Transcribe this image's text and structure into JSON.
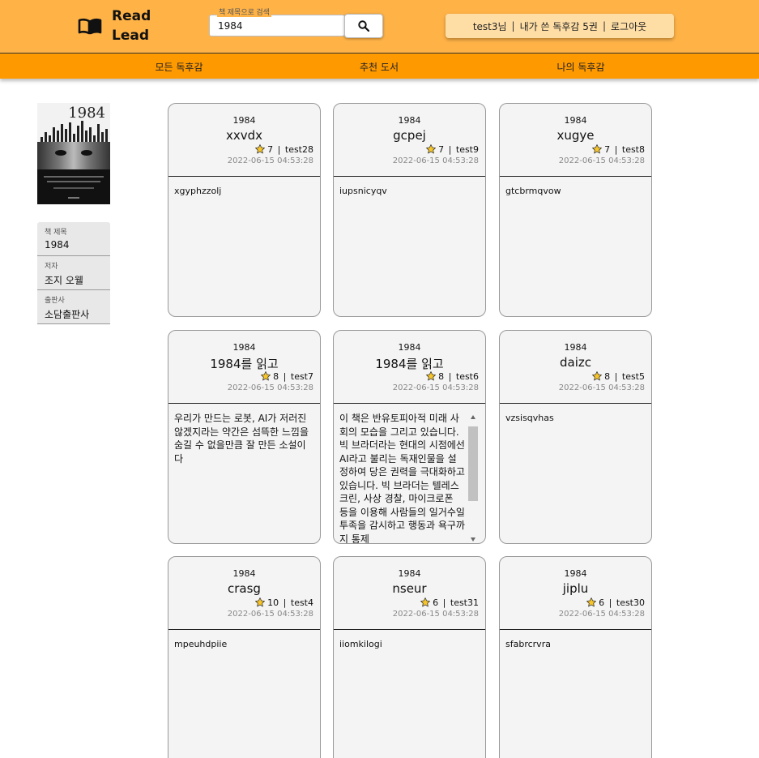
{
  "header": {
    "logo_line1": "Read",
    "logo_line2": "Lead",
    "search_label": "책 제목으로 검색",
    "search_value": "1984",
    "user_name": "test3님",
    "my_review_count": "내가 쓴 독후감 5권",
    "logout": "로그아웃",
    "colors": {
      "header_bg": "#ffb347",
      "nav_bg": "#ff9900",
      "user_box_bg": "#ffdea6"
    }
  },
  "nav": {
    "items": [
      {
        "label": "모든 독후감"
      },
      {
        "label": "추천 도서"
      },
      {
        "label": "나의 독후감"
      }
    ]
  },
  "book": {
    "cover_title": "1984",
    "fields": [
      {
        "label": "책 제목",
        "value": "1984"
      },
      {
        "label": "저자",
        "value": "조지 오웰"
      },
      {
        "label": "출판사",
        "value": "소담출판사"
      }
    ]
  },
  "reviews": [
    {
      "book": "1984",
      "title": "xxvdx",
      "rating": "7",
      "user": "test28",
      "date": "2022-06-15 04:53:28",
      "body": "xgyphzzolj"
    },
    {
      "book": "1984",
      "title": "gcpej",
      "rating": "7",
      "user": "test9",
      "date": "2022-06-15 04:53:28",
      "body": "iupsnicyqv"
    },
    {
      "book": "1984",
      "title": "xugye",
      "rating": "7",
      "user": "test8",
      "date": "2022-06-15 04:53:28",
      "body": "gtcbrmqvow"
    },
    {
      "book": "1984",
      "title": "1984를 읽고",
      "rating": "8",
      "user": "test7",
      "date": "2022-06-15 04:53:28",
      "body": "우리가 만드는 로봇, AI가 저러진 않겠지라는 약간은 섬뜩한 느낌을 숨길 수 없을만큼 잘 만든 소설이다"
    },
    {
      "book": "1984",
      "title": "1984를 읽고",
      "rating": "8",
      "user": "test6",
      "date": "2022-06-15 04:53:28",
      "body": "이 책은 반유토피아적 미래 사회의 모습을 그리고 있습니다. 빅 브라더라는 현대의 시점에선 AI라고 불리는 독재인물을 설정하여 당은 권력을 극대화하고 있습니다. 빅 브라더는 텔레스크린, 사상 경찰, 마이크로폰 등을 이용해 사람들의 일거수일투족을 감시하고 행동과 욕구까지 통제"
    },
    {
      "book": "1984",
      "title": "daizc",
      "rating": "8",
      "user": "test5",
      "date": "2022-06-15 04:53:28",
      "body": "vzsisqvhas"
    },
    {
      "book": "1984",
      "title": "crasg",
      "rating": "10",
      "user": "test4",
      "date": "2022-06-15 04:53:28",
      "body": "mpeuhdpiie"
    },
    {
      "book": "1984",
      "title": "nseur",
      "rating": "6",
      "user": "test31",
      "date": "2022-06-15 04:53:28",
      "body": "iiomkilogi"
    },
    {
      "book": "1984",
      "title": "jiplu",
      "rating": "6",
      "user": "test30",
      "date": "2022-06-15 04:53:28",
      "body": "sfabrcrvra"
    }
  ]
}
